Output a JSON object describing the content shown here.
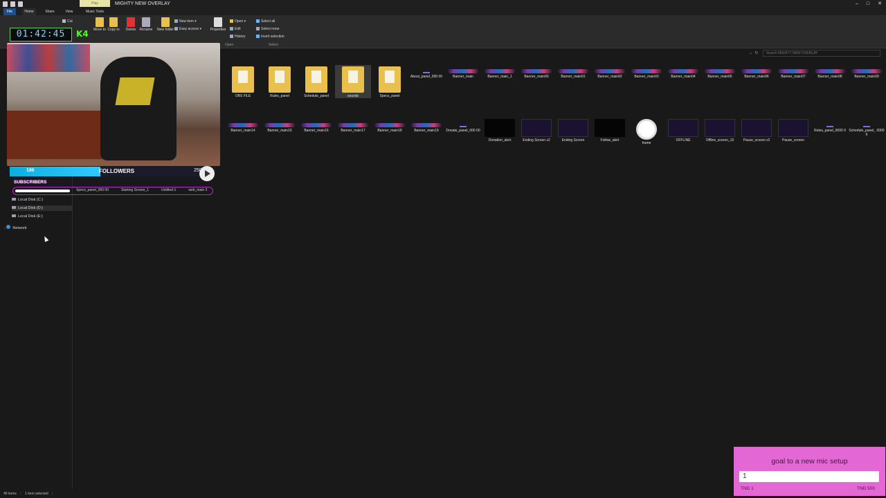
{
  "window": {
    "title": "MIGHTY NEW OVERLAY",
    "context_tab": "Play"
  },
  "ribbon_tabs": [
    "File",
    "Home",
    "Share",
    "View",
    "Music Tools"
  ],
  "ribbon": {
    "cut": "Cut",
    "move_to": "Move to",
    "copy_to": "Copy to",
    "delete": "Delete",
    "rename": "Rename",
    "new_folder": "New folder",
    "new_item": "New item",
    "easy_access": "Easy access",
    "properties": "Properties",
    "open": "Open",
    "edit": "Edit",
    "history": "History",
    "select_all": "Select all",
    "select_none": "Select none",
    "invert_selection": "Invert selection",
    "group_open": "Open",
    "group_select": "Select"
  },
  "search": {
    "placeholder": "Search MIGHTY NEW OVERLAY"
  },
  "nav": {
    "disk_c": "Local Disk (C:)",
    "disk_d": "Local Disk (D:)",
    "disk_e": "Local Disk (E:)",
    "network": "Network"
  },
  "files_row1": [
    {
      "name": "OBS FILE",
      "kind": "folder"
    },
    {
      "name": "Rules_panel",
      "kind": "folder"
    },
    {
      "name": "Schedule_panel",
      "kind": "folder"
    },
    {
      "name": "sounds",
      "kind": "folder"
    },
    {
      "name": "Specs_panel",
      "kind": "folder"
    },
    {
      "name": "About_panel_000 00",
      "kind": "tiny"
    },
    {
      "name": "Banner_main",
      "kind": "banner"
    },
    {
      "name": "Banner_main_1",
      "kind": "banner"
    },
    {
      "name": "Banner_main00",
      "kind": "banner"
    },
    {
      "name": "Banner_main01",
      "kind": "banner"
    },
    {
      "name": "Banner_main02",
      "kind": "banner"
    },
    {
      "name": "Banner_main03",
      "kind": "banner"
    },
    {
      "name": "Banner_main04",
      "kind": "banner"
    },
    {
      "name": "Banner_main05",
      "kind": "banner"
    },
    {
      "name": "Banner_main06",
      "kind": "banner"
    },
    {
      "name": "Banner_main07",
      "kind": "banner"
    },
    {
      "name": "Banner_main08",
      "kind": "banner"
    },
    {
      "name": "Banner_main09",
      "kind": "banner"
    }
  ],
  "files_row2": [
    {
      "name": "Banner_main14",
      "kind": "banner"
    },
    {
      "name": "Banner_main15",
      "kind": "banner"
    },
    {
      "name": "Banner_main16",
      "kind": "banner"
    },
    {
      "name": "Banner_main17",
      "kind": "banner"
    },
    {
      "name": "Banner_main18",
      "kind": "banner"
    },
    {
      "name": "Banner_main19",
      "kind": "banner"
    },
    {
      "name": "Donate_panel_000 00",
      "kind": "tiny"
    },
    {
      "name": "Donation_alert",
      "kind": "dark"
    },
    {
      "name": "Ending Screen v2",
      "kind": "vid"
    },
    {
      "name": "Ending Screen",
      "kind": "vid"
    },
    {
      "name": "Follow_alert",
      "kind": "dark"
    },
    {
      "name": "frame",
      "kind": "play"
    },
    {
      "name": "OFFLINE",
      "kind": "vid"
    },
    {
      "name": "Offline_screen_10",
      "kind": "vid"
    },
    {
      "name": "Pause_screen v2",
      "kind": "vid"
    },
    {
      "name": "Pause_screen",
      "kind": "vid"
    },
    {
      "name": "Rules_panel_0000 0",
      "kind": "tiny"
    },
    {
      "name": "Schedule_panel_ 00000",
      "kind": "tiny"
    }
  ],
  "status": {
    "items": "48 items",
    "selected": "1 item selected"
  },
  "overlay": {
    "timer": "01:42:45",
    "kick_count": "4",
    "followers_current": "186",
    "followers_label": "FOLLOWERS",
    "followers_max": "250",
    "followers_progress": 0.744,
    "subscribers_label": "SUBSCRIBERS",
    "subscribers_progress": 0.28,
    "obscured_files": [
      "Specs_panel_000 00",
      "Starting Screen_1",
      "Untitled-1",
      "web_main 2"
    ]
  },
  "goal": {
    "title": "goal to a new mic setup",
    "current": "1",
    "min_label": "TND 1",
    "max_label": "TND 500",
    "progress": 0.002
  },
  "colors": {
    "goal_bg": "#e368d6",
    "followers_fill": "#0ab0e0",
    "subs_border": "#c01fd6",
    "folder": "#e8c04b"
  }
}
